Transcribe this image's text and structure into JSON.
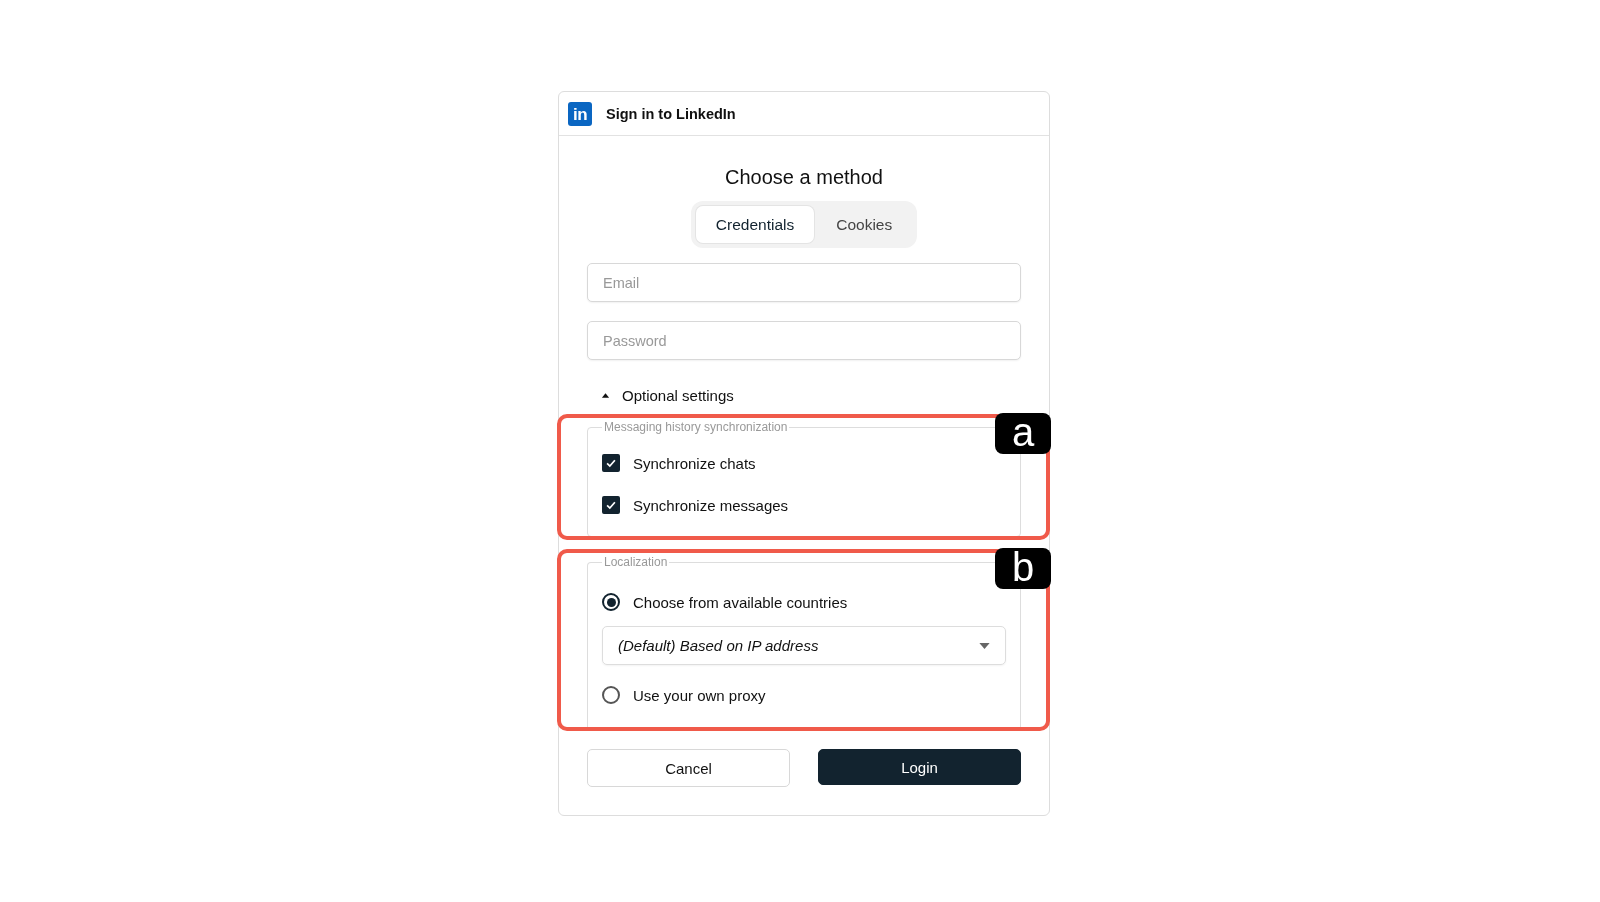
{
  "window": {
    "logo_text": "in",
    "title": "Sign in to LinkedIn"
  },
  "heading": "Choose a method",
  "tabs": [
    {
      "label": "Credentials",
      "selected": true
    },
    {
      "label": "Cookies",
      "selected": false
    }
  ],
  "fields": [
    {
      "placeholder": "Email"
    },
    {
      "placeholder": "Password"
    }
  ],
  "optional_settings": {
    "label": "Optional settings",
    "expanded": true
  },
  "groups": [
    {
      "legend": "Messaging history synchronization",
      "annotation": "a",
      "options": [
        {
          "kind": "checkbox",
          "label": "Synchronize chats",
          "checked": true
        },
        {
          "kind": "checkbox",
          "label": "Synchronize messages",
          "checked": true
        }
      ]
    },
    {
      "legend": "Localization",
      "annotation": "b",
      "options": [
        {
          "kind": "radio",
          "label": "Choose from available countries",
          "selected": true
        },
        {
          "kind": "select",
          "value": "(Default) Based on IP address"
        },
        {
          "kind": "radio",
          "label": "Use your own proxy",
          "selected": false
        }
      ]
    }
  ],
  "buttons": [
    {
      "label": "Cancel",
      "kind": "secondary"
    },
    {
      "label": "Login",
      "kind": "primary"
    }
  ]
}
